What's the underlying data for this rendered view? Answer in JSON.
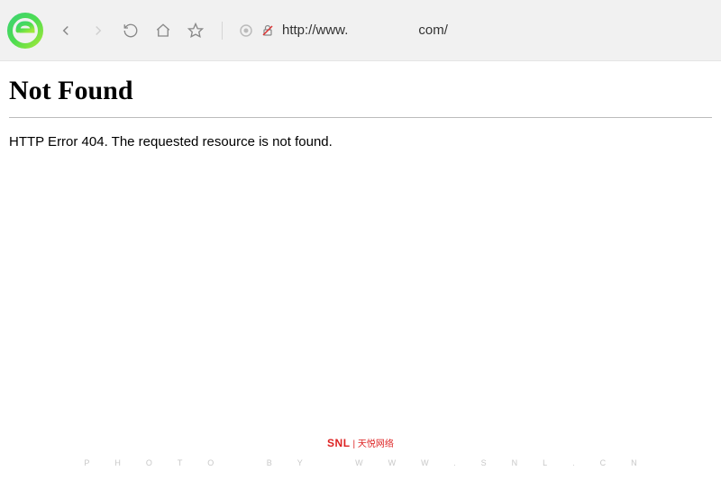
{
  "toolbar": {
    "url_prefix": "http://www.",
    "url_suffix": "com/"
  },
  "page": {
    "title": "Not Found",
    "message": "HTTP Error 404. The requested resource is not found."
  },
  "footer": {
    "brand_main": "SNL",
    "brand_sub": "| 天悦网络",
    "letters": "PHOTO BY WWW.SNL.CN"
  }
}
